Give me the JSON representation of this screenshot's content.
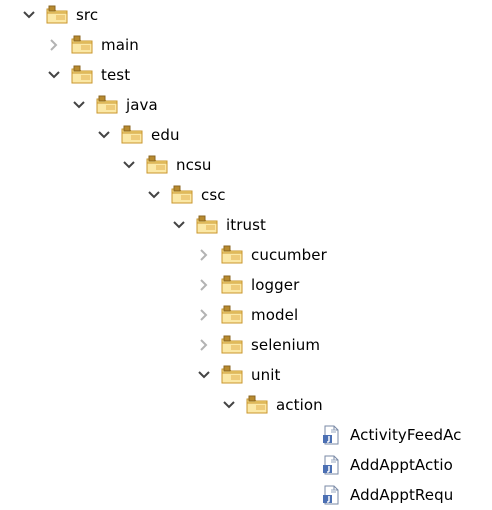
{
  "tree": {
    "items": [
      {
        "label": "src",
        "expanded": true,
        "icon": "package-folder-icon"
      },
      {
        "label": "main",
        "expanded": false,
        "icon": "package-folder-icon"
      },
      {
        "label": "test",
        "expanded": true,
        "icon": "package-folder-icon"
      },
      {
        "label": "java",
        "expanded": true,
        "icon": "package-folder-icon"
      },
      {
        "label": "edu",
        "expanded": true,
        "icon": "package-folder-icon"
      },
      {
        "label": "ncsu",
        "expanded": true,
        "icon": "package-folder-icon"
      },
      {
        "label": "csc",
        "expanded": true,
        "icon": "package-folder-icon"
      },
      {
        "label": "itrust",
        "expanded": true,
        "icon": "package-folder-icon"
      },
      {
        "label": "cucumber",
        "expanded": false,
        "icon": "package-folder-icon"
      },
      {
        "label": "logger",
        "expanded": false,
        "icon": "package-folder-icon"
      },
      {
        "label": "model",
        "expanded": false,
        "icon": "package-folder-icon"
      },
      {
        "label": "selenium",
        "expanded": false,
        "icon": "package-folder-icon"
      },
      {
        "label": "unit",
        "expanded": true,
        "icon": "package-folder-icon"
      },
      {
        "label": "action",
        "expanded": true,
        "icon": "package-folder-icon"
      },
      {
        "label": "ActivityFeedAc",
        "icon": "java-file-icon"
      },
      {
        "label": "AddApptActio",
        "icon": "java-file-icon"
      },
      {
        "label": "AddApptRequ",
        "icon": "java-file-icon"
      }
    ]
  },
  "colors": {
    "folder_light": "#f7de86",
    "folder_dark": "#c8962d",
    "package_badge": "#b88b2f",
    "chevron_expanded": "#444444",
    "chevron_collapsed": "#b3b3b3",
    "file_page": "#ffffff",
    "file_border": "#7a8aa6",
    "file_badge": "#4b6fb3"
  }
}
